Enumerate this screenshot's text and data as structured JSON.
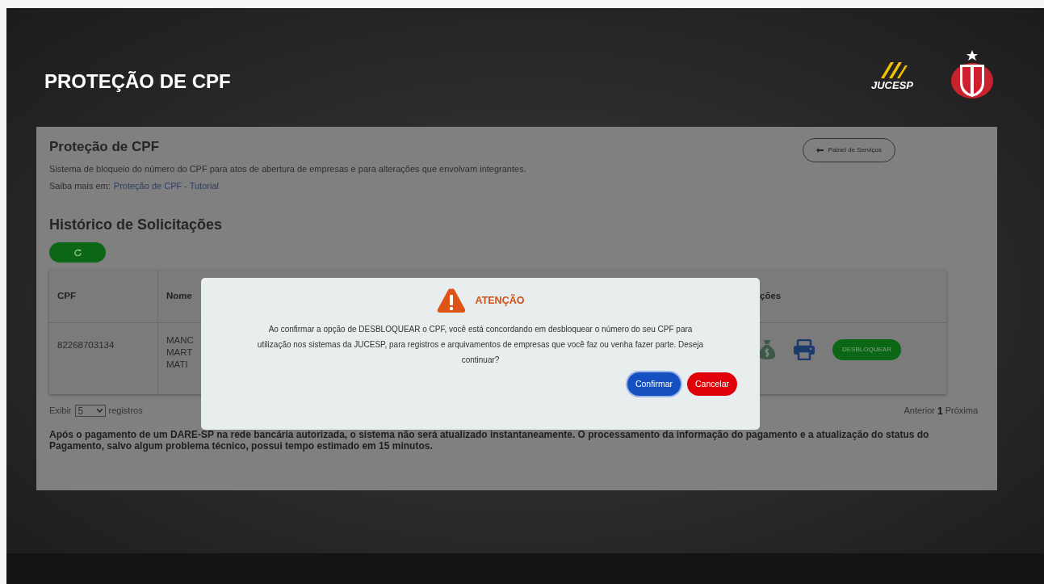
{
  "header": {
    "title": "PROTEÇÃO DE CPF",
    "logo_text": "JUCESP"
  },
  "panel": {
    "title": "Proteção de CPF",
    "back_button": "Painel de Serviços",
    "description": "Sistema de bloqueio do número do CPF para atos de abertura de empresas e para alterações que envolvam integrantes.",
    "learn_more_label": "Saiba mais em:",
    "learn_more_link": "Proteção de CPF - Tutorial"
  },
  "history": {
    "title": "Histórico de Solicitações"
  },
  "table": {
    "columns": [
      "CPF",
      "Nome",
      "ções"
    ],
    "rows": [
      {
        "cpf": "82268703134",
        "name_lines": [
          "MANC",
          "MART",
          "MATI"
        ],
        "action_button": "DESBLOQUEAR"
      }
    ]
  },
  "page_size": {
    "label_before": "Exibir",
    "value": "5",
    "label_after": "registros"
  },
  "pagination": {
    "previous": "Anterior",
    "pages": [
      {
        "label": "1",
        "selected": true
      }
    ],
    "next": "Próxima"
  },
  "notice": "Após o pagamento de um DARE-SP na rede bancária autorizada, o sistema não será atualizado instantaneamente. O processamento da informação do pagamento e a atualização do status do Pagamento, salvo algum problema técnico, possui tempo estimado em 15 minutos.",
  "dialog": {
    "title": "ATENÇÃO",
    "message": "Ao confirmar a opção de DESBLOQUEAR o CPF, você está concordando em desbloquear o número do seu CPF para utilização nos sistemas da JUCESP, para registros e arquivamentos de empresas que você faz ou venha fazer parte. Deseja continuar?",
    "buttons": [
      {
        "label": "Confirmar",
        "kind": "primary"
      },
      {
        "label": "Cancelar",
        "kind": "danger"
      }
    ]
  }
}
